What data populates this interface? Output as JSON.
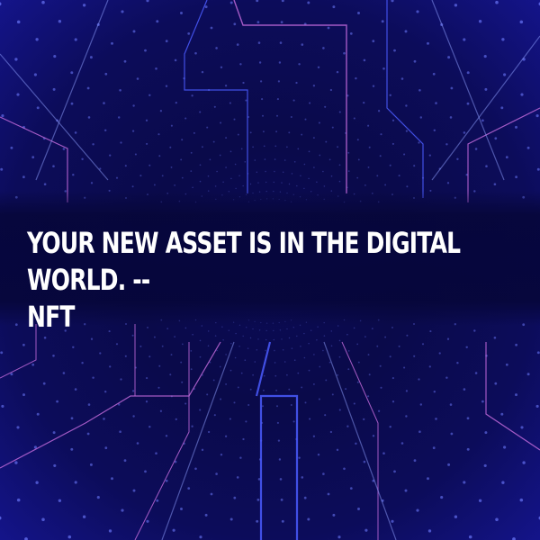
{
  "quote": {
    "line1": "YOUR NEW ASSET IS IN THE DIGITAL WORLD. --",
    "line2": "NFT"
  },
  "colors": {
    "background": "#0a0a4a",
    "dots": "#6f7cff",
    "lines_blue": "#4b5cff",
    "lines_pink": "#c069d8",
    "text": "#ffffff"
  }
}
